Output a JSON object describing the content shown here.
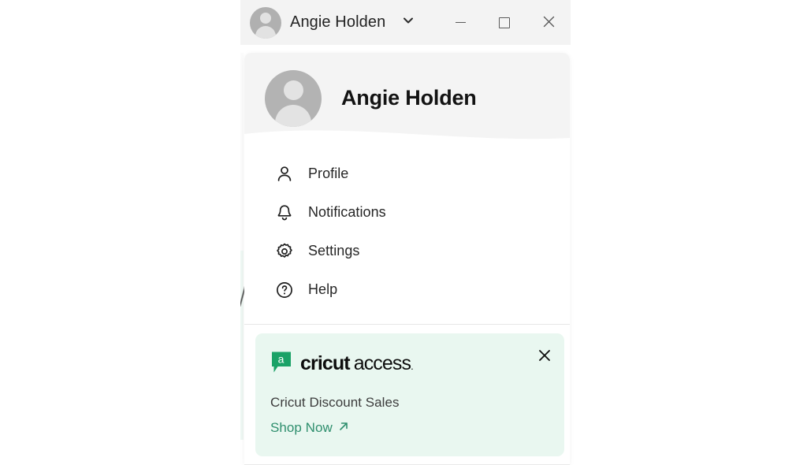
{
  "titlebar": {
    "user_name": "Angie Holden",
    "avatar_icon": "user-avatar-icon",
    "chevron_icon": "chevron-down-icon",
    "minimize_label": "Minimize",
    "maximize_label": "Maximize",
    "close_label": "Close"
  },
  "panel": {
    "header": {
      "display_name": "Angie Holden",
      "avatar_icon": "user-avatar-icon"
    },
    "menu": [
      {
        "label": "Profile",
        "icon": "person-icon"
      },
      {
        "label": "Notifications",
        "icon": "bell-icon"
      },
      {
        "label": "Settings",
        "icon": "gear-icon"
      },
      {
        "label": "Help",
        "icon": "question-circle-icon"
      }
    ],
    "promo": {
      "badge_letter": "a",
      "brand_bold": "cricut",
      "brand_light": "access",
      "brand_mark": ".",
      "message": "Cricut Discount Sales",
      "cta_label": "Shop Now",
      "cta_icon": "arrow-up-right-icon",
      "close_icon": "close-icon"
    }
  },
  "colors": {
    "brand_green": "#21a366",
    "promo_bg": "#e9f7f0",
    "link_green": "#2f8f6e",
    "titlebar_bg": "#f3f3f3",
    "header_bg": "#f4f4f4"
  }
}
